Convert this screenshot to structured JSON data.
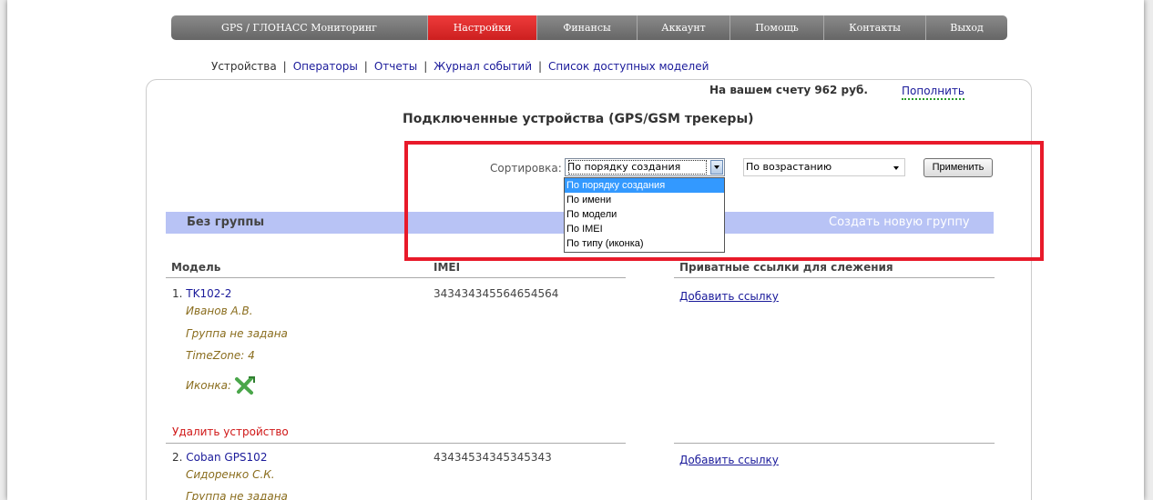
{
  "nav": [
    {
      "label": "GPS / ГЛОНАСС Мониторинг",
      "active": false
    },
    {
      "label": "Настройки",
      "active": true
    },
    {
      "label": "Финансы",
      "active": false
    },
    {
      "label": "Аккаунт",
      "active": false
    },
    {
      "label": "Помощь",
      "active": false
    },
    {
      "label": "Контакты",
      "active": false
    },
    {
      "label": "Выход",
      "active": false
    }
  ],
  "subnav": {
    "current": "Устройства",
    "operators": "Операторы",
    "reports": "Отчеты",
    "events": "Журнал событий",
    "models": "Список доступных моделей",
    "separator": "|"
  },
  "balance": {
    "text": "На вашем счету 962 руб.",
    "topup": "Пополнить"
  },
  "page_title": "Подключенные устройства (GPS/GSM трекеры)",
  "sort": {
    "label": "Сортировка:",
    "selected": "По порядку создания",
    "options": [
      "По порядку создания",
      "По имени",
      "По модели",
      "По IMEI",
      "По типу (иконка)"
    ],
    "order_selected": "По возрастанию",
    "apply": "Применить"
  },
  "group": {
    "name": "Без группы",
    "create": "Создать новую группу"
  },
  "columns": {
    "model": "Модель",
    "imei": "IMEI",
    "links": "Приватные ссылки для слежения"
  },
  "devices": [
    {
      "num": "1.",
      "model": "TK102-2",
      "owner": "Иванов А.В.",
      "group": "Группа не задана",
      "timezone": "TimeZone: 4",
      "icon_label": "Иконка:",
      "imei": "343434345564654564",
      "add_link": "Добавить ссылку",
      "delete": "Удалить устройство"
    },
    {
      "num": "2.",
      "model": "Coban GPS102",
      "owner": "Сидоренко С.К.",
      "group": "Группа не задана",
      "imei": "43434534345345343",
      "add_link": "Добавить ссылку"
    }
  ],
  "colors": {
    "active_tab": "#dd2c2c",
    "link": "#1a1a9a",
    "owner": "#8a6d1e",
    "group_bar": "#b8c3f5",
    "highlight_box": "#e81a2a"
  }
}
